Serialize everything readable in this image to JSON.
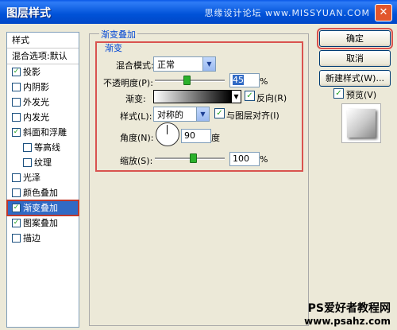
{
  "window": {
    "title": "图层样式",
    "watermark": "思缘设计论坛 www.MISSYUAN.COM",
    "close_glyph": "✕"
  },
  "styles_panel": {
    "items": [
      {
        "label": "样式",
        "checked": null
      },
      {
        "label": "混合选项:默认",
        "checked": null
      },
      {
        "label": "投影",
        "checked": true
      },
      {
        "label": "内阴影",
        "checked": false
      },
      {
        "label": "外发光",
        "checked": false
      },
      {
        "label": "内发光",
        "checked": false
      },
      {
        "label": "斜面和浮雕",
        "checked": true
      },
      {
        "label": "等高线",
        "checked": false
      },
      {
        "label": "纹理",
        "checked": false
      },
      {
        "label": "光泽",
        "checked": false
      },
      {
        "label": "颜色叠加",
        "checked": false
      },
      {
        "label": "渐变叠加",
        "checked": true
      },
      {
        "label": "图案叠加",
        "checked": true
      },
      {
        "label": "描边",
        "checked": false
      }
    ]
  },
  "gradient_overlay": {
    "group_title": "渐变叠加",
    "section_title": "渐变",
    "blend_mode_label": "混合模式:",
    "blend_mode_value": "正常",
    "opacity_label": "不透明度(P):",
    "opacity_value": "45",
    "opacity_unit": "%",
    "opacity_level": 0.45,
    "gradient_label": "渐变:",
    "reverse_label": "反向(R)",
    "reverse_checked": true,
    "style_label": "样式(L):",
    "style_value": "对称的",
    "align_label": "与图层对齐(I)",
    "align_checked": true,
    "angle_label": "角度(N):",
    "angle_value": "90",
    "angle_unit": "度",
    "scale_label": "缩放(S):",
    "scale_value": "100",
    "scale_unit": "%",
    "scale_level": 0.55
  },
  "buttons": {
    "ok": "确定",
    "cancel": "取消",
    "new_style": "新建样式(W)...",
    "preview_label": "预览(V)",
    "preview_checked": true
  },
  "footer": {
    "line1": "PS爱好者教程网",
    "line2": "www.psahz.com"
  },
  "colors": {
    "title_bar": "#0052d8",
    "selection": "#316ac5",
    "highlight_box": "#d9534f",
    "check": "#21a121"
  }
}
